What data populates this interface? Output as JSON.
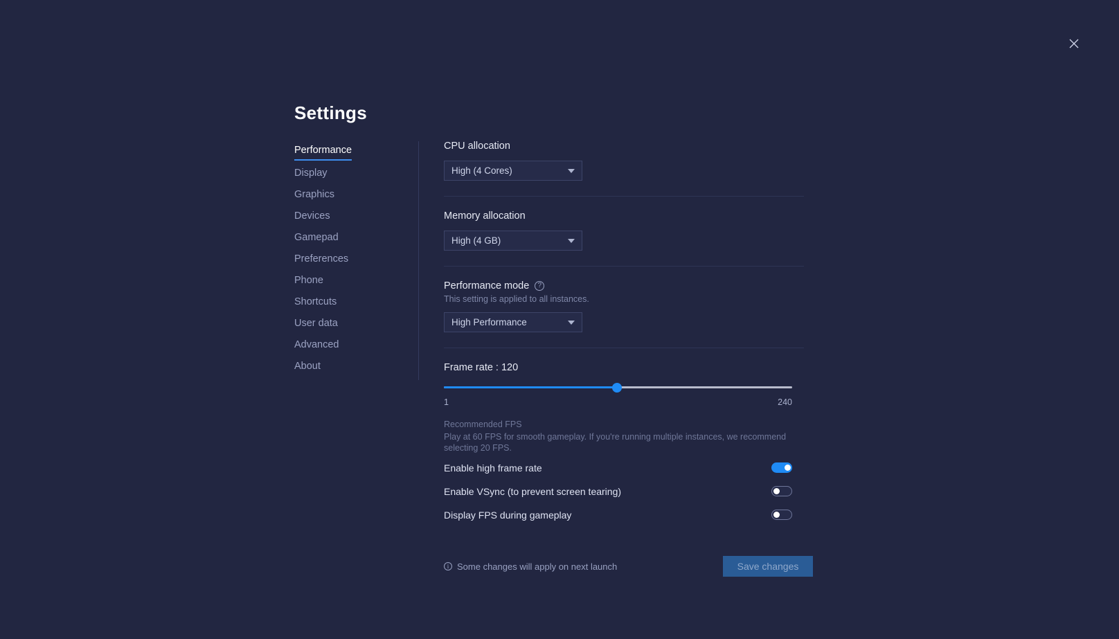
{
  "window": {
    "close_label": "close-icon"
  },
  "header": {
    "title": "Settings"
  },
  "sidebar": {
    "items": [
      {
        "label": "Performance",
        "active": true
      },
      {
        "label": "Display",
        "active": false
      },
      {
        "label": "Graphics",
        "active": false
      },
      {
        "label": "Devices",
        "active": false
      },
      {
        "label": "Gamepad",
        "active": false
      },
      {
        "label": "Preferences",
        "active": false
      },
      {
        "label": "Phone",
        "active": false
      },
      {
        "label": "Shortcuts",
        "active": false
      },
      {
        "label": "User data",
        "active": false
      },
      {
        "label": "Advanced",
        "active": false
      },
      {
        "label": "About",
        "active": false
      }
    ]
  },
  "main": {
    "cpu": {
      "label": "CPU allocation",
      "value": "High (4 Cores)"
    },
    "memory": {
      "label": "Memory allocation",
      "value": "High (4 GB)"
    },
    "performance_mode": {
      "label": "Performance mode",
      "help_icon": "?",
      "note": "This setting is applied to all instances.",
      "value": "High Performance"
    },
    "frame_rate": {
      "label": "Frame rate : 120",
      "value": 120,
      "min_label": "1",
      "max_label": "240",
      "min": 1,
      "max": 240,
      "fill_color": "#1f8bf5",
      "track_color": "#b9bccd"
    },
    "recommended": {
      "title": "Recommended FPS",
      "body": "Play at 60 FPS for smooth gameplay. If you're running multiple instances, we recommend selecting 20 FPS."
    },
    "toggles": [
      {
        "label": "Enable high frame rate",
        "on": true
      },
      {
        "label": "Enable VSync (to prevent screen tearing)",
        "on": false
      },
      {
        "label": "Display FPS during gameplay",
        "on": false
      }
    ]
  },
  "footer": {
    "info_icon": "i",
    "note": "Some changes will apply on next launch",
    "save_label": "Save changes"
  }
}
